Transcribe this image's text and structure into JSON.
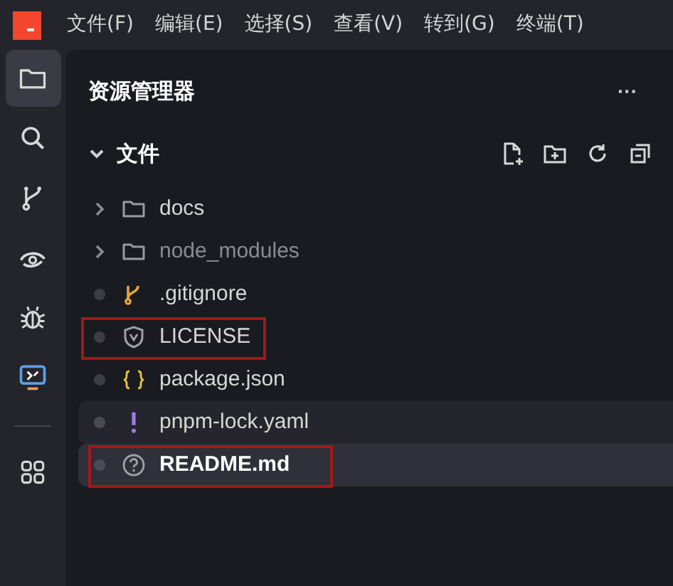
{
  "menu_bar": {
    "items": [
      "文件(F)",
      "编辑(E)",
      "选择(S)",
      "查看(V)",
      "转到(G)",
      "终端(T)"
    ]
  },
  "activity_bar": {
    "items": [
      {
        "kind": "files",
        "selected": true
      },
      {
        "kind": "search",
        "selected": false
      },
      {
        "kind": "branch",
        "selected": false
      },
      {
        "kind": "eye",
        "selected": false
      },
      {
        "kind": "bug",
        "selected": false
      },
      {
        "kind": "remote",
        "selected": false
      },
      {
        "kind": "grid",
        "selected": false
      }
    ]
  },
  "explorer": {
    "title": "资源管理器",
    "more": "···",
    "section": {
      "title": "文件",
      "expanded": true
    },
    "items": [
      {
        "kind": "folder",
        "name": "docs",
        "dimmed": false,
        "selected": false,
        "hovered": false,
        "annotated": false
      },
      {
        "kind": "folder",
        "name": "node_modules",
        "dimmed": true,
        "selected": false,
        "hovered": false,
        "annotated": false
      },
      {
        "kind": "git",
        "name": ".gitignore",
        "dimmed": false,
        "selected": false,
        "hovered": false,
        "annotated": false
      },
      {
        "kind": "license",
        "name": "LICENSE",
        "dimmed": false,
        "selected": false,
        "hovered": false,
        "annotated": true
      },
      {
        "kind": "json",
        "name": "package.json",
        "dimmed": false,
        "selected": false,
        "hovered": false,
        "annotated": false
      },
      {
        "kind": "yaml",
        "name": "pnpm-lock.yaml",
        "dimmed": false,
        "selected": false,
        "hovered": true,
        "annotated": false
      },
      {
        "kind": "readme",
        "name": "README.md",
        "dimmed": false,
        "selected": true,
        "hovered": false,
        "annotated": true
      }
    ]
  }
}
